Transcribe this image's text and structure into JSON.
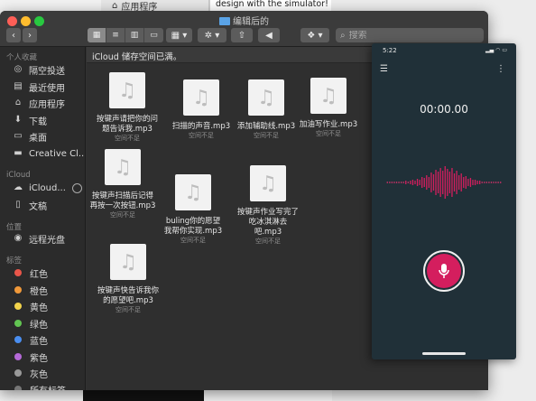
{
  "background": {
    "apps_label": "应用程序",
    "doc_text": "design with the simulator!"
  },
  "window": {
    "title": "编辑后的",
    "search_placeholder": "搜索"
  },
  "sidebar": {
    "favorites_header": "个人收藏",
    "favorites": [
      {
        "label": "隔空投送",
        "icon": "airdrop-icon"
      },
      {
        "label": "最近使用",
        "icon": "recents-icon"
      },
      {
        "label": "应用程序",
        "icon": "applications-icon"
      },
      {
        "label": "下载",
        "icon": "downloads-icon"
      },
      {
        "label": "桌面",
        "icon": "desktop-icon"
      },
      {
        "label": "Creative Cl...",
        "icon": "folder-icon"
      }
    ],
    "icloud_header": "iCloud",
    "icloud": [
      {
        "label": "iCloud...",
        "icon": "cloud-icon"
      },
      {
        "label": "文稿",
        "icon": "documents-icon"
      }
    ],
    "locations_header": "位置",
    "locations": [
      {
        "label": "远程光盘",
        "icon": "disc-icon"
      }
    ],
    "tags_header": "标签",
    "tags": [
      {
        "label": "红色",
        "color": "#e9564a"
      },
      {
        "label": "橙色",
        "color": "#f0993a"
      },
      {
        "label": "黄色",
        "color": "#f2d34b"
      },
      {
        "label": "绿色",
        "color": "#62c552"
      },
      {
        "label": "蓝色",
        "color": "#4a8ef0"
      },
      {
        "label": "紫色",
        "color": "#b569d8"
      },
      {
        "label": "灰色",
        "color": "#9a9a9a"
      },
      {
        "label": "所有标签...",
        "color": "#777777"
      }
    ]
  },
  "main": {
    "banner": "iCloud 储存空间已满。",
    "files": [
      {
        "name": "按键声请把你的问题告诉我.mp3",
        "status": "空间不足"
      },
      {
        "name": "扫描的声音.mp3",
        "status": "空间不足"
      },
      {
        "name": "添加辅助线.mp3",
        "status": "空间不足"
      },
      {
        "name": "加油写作业.mp3",
        "status": "空间不足"
      },
      {
        "name": "按键声扫描后记得再按一次按钮.mp3",
        "status": "空间不足"
      },
      {
        "name": "buling你的愿望我帮你实现.mp3",
        "status": "空间不足"
      },
      {
        "name": "按键声作业写完了吃冰淇淋去吧.mp3",
        "status": "空间不足"
      },
      {
        "name": "按键声快告诉我你的愿望吧.mp3",
        "status": "空间不足"
      }
    ]
  },
  "phone": {
    "time": "5:22",
    "timer": "00:00.00",
    "accent": "#d41e5e",
    "background": "#203038"
  }
}
